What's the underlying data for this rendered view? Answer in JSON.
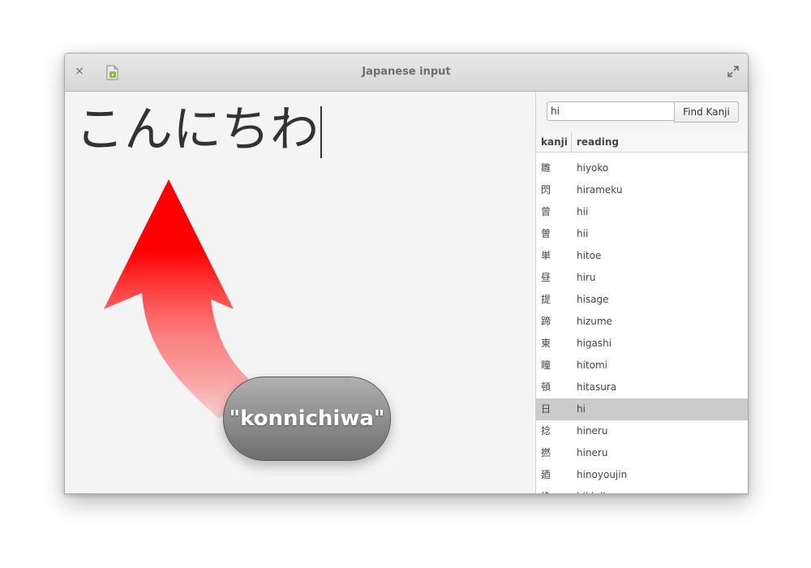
{
  "window": {
    "title": "Japanese input",
    "close_glyph": "×"
  },
  "editor": {
    "text": "こんにちわ"
  },
  "voice": {
    "label": "\"konnichiwa\""
  },
  "search": {
    "value": "hi",
    "button_label": "Find Kanji"
  },
  "table": {
    "headers": {
      "kanji": "kanji",
      "reading": "reading"
    },
    "rows": [
      {
        "kanji": "雛",
        "reading": "hiyoko"
      },
      {
        "kanji": "閃",
        "reading": "hirameku"
      },
      {
        "kanji": "曾",
        "reading": "hii"
      },
      {
        "kanji": "曽",
        "reading": "hii"
      },
      {
        "kanji": "単",
        "reading": "hitoe"
      },
      {
        "kanji": "昼",
        "reading": "hiru"
      },
      {
        "kanji": "提",
        "reading": "hisage"
      },
      {
        "kanji": "蹄",
        "reading": "hizume"
      },
      {
        "kanji": "東",
        "reading": "higashi"
      },
      {
        "kanji": "瞳",
        "reading": "hitomi"
      },
      {
        "kanji": "頓",
        "reading": "hitasura"
      },
      {
        "kanji": "日",
        "reading": "hi"
      },
      {
        "kanji": "捻",
        "reading": "hineru"
      },
      {
        "kanji": "撚",
        "reading": "hineru"
      },
      {
        "kanji": "廼",
        "reading": "hinoyoujin"
      },
      {
        "kanji": "挽",
        "reading": "hikiniku"
      }
    ],
    "selected_index": 11
  },
  "icons": {
    "close": "close-icon",
    "app": "app-document-icon",
    "maximize": "maximize-icon",
    "arrow": "curved-up-arrow"
  },
  "colors": {
    "arrow": "#ff0000",
    "selection": "#cbcbcb"
  }
}
